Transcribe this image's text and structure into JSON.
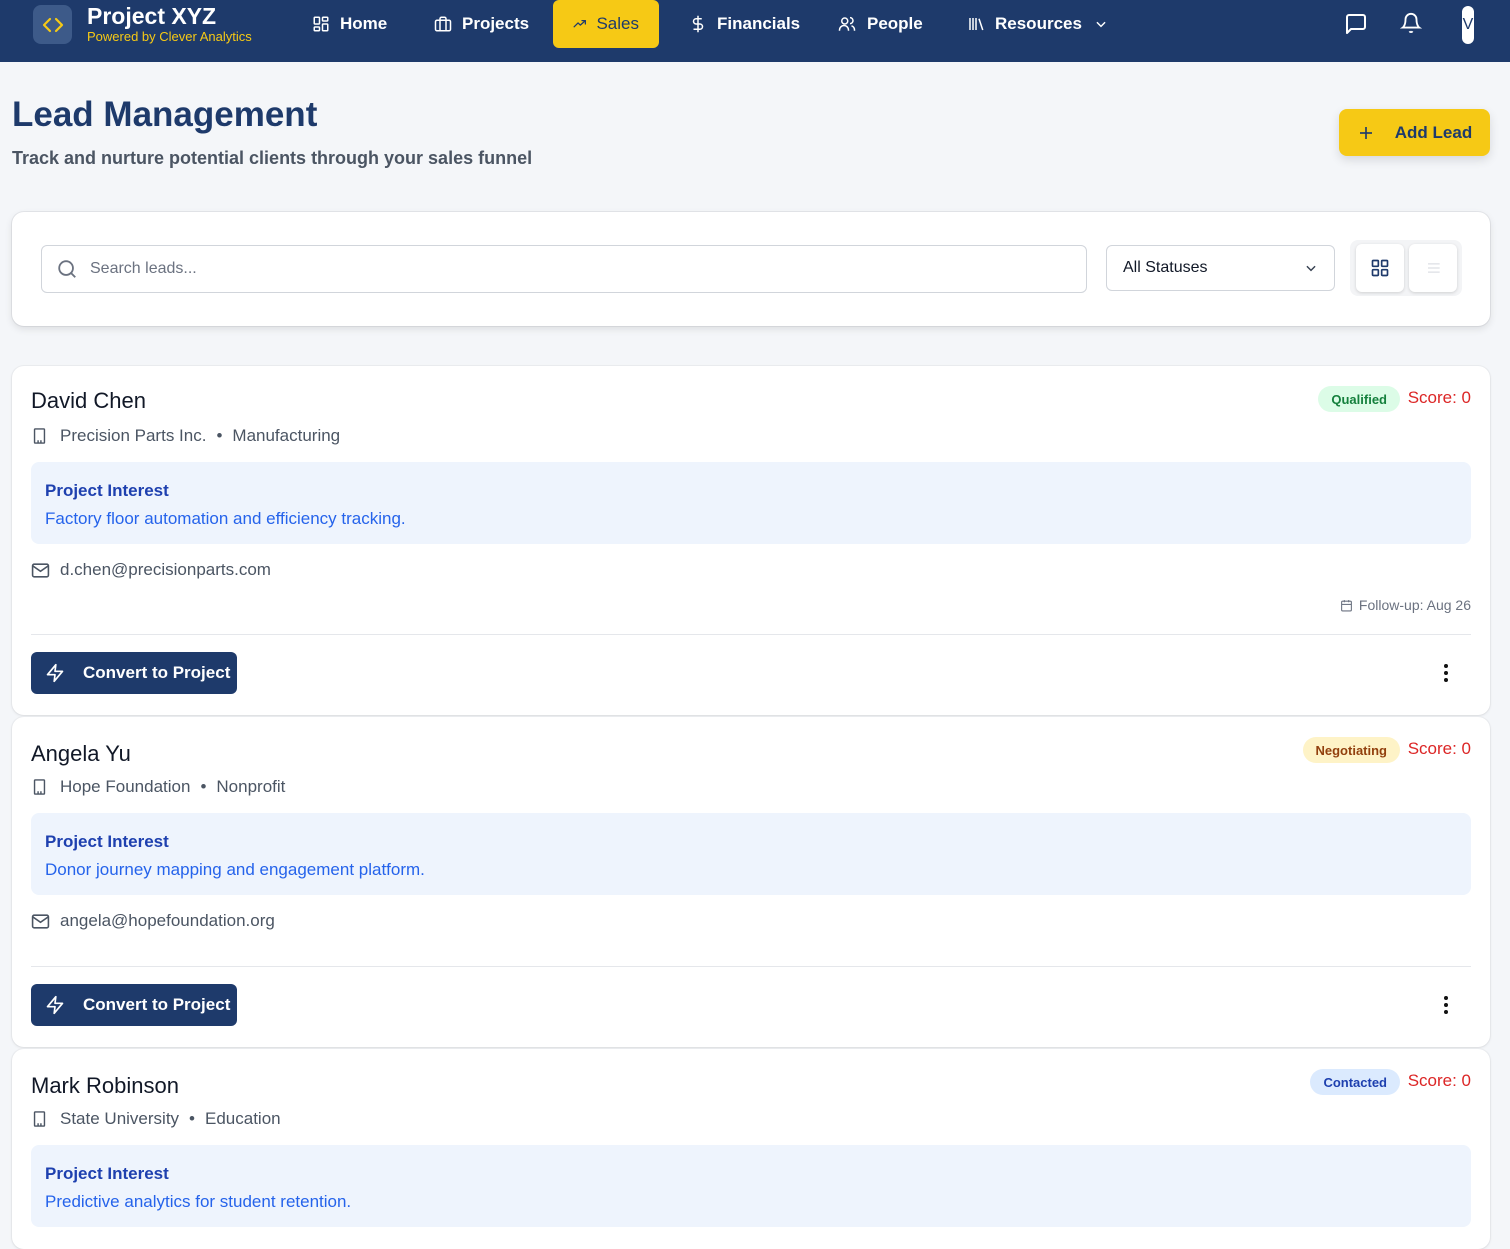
{
  "app": {
    "title": "Project XYZ",
    "subtitle": "Powered by Clever Analytics",
    "avatar_initial": "V"
  },
  "nav": {
    "items": [
      {
        "label": "Home",
        "icon": "grid-icon"
      },
      {
        "label": "Projects",
        "icon": "briefcase-icon"
      },
      {
        "label": "Sales",
        "icon": "trending-up-icon",
        "active": true
      },
      {
        "label": "Financials",
        "icon": "dollar-icon"
      },
      {
        "label": "People",
        "icon": "users-icon"
      },
      {
        "label": "Resources",
        "icon": "library-icon"
      }
    ]
  },
  "header": {
    "title": "Lead Management",
    "subtitle": "Track and nurture potential clients through your sales funnel",
    "add_label": "Add Lead"
  },
  "filters": {
    "search_placeholder": "Search leads...",
    "status_selected": "All Statuses"
  },
  "leads": [
    {
      "name": "David Chen",
      "status": "Qualified",
      "score": "Score: 0",
      "company": "Precision Parts Inc.",
      "industry": "Manufacturing",
      "interest_label": "Project Interest",
      "interest": "Factory floor automation and efficiency tracking.",
      "email": "d.chen@precisionparts.com",
      "followup": "Follow-up: Aug 26",
      "convert_label": "Convert to Project"
    },
    {
      "name": "Angela Yu",
      "status": "Negotiating",
      "score": "Score: 0",
      "company": "Hope Foundation",
      "industry": "Nonprofit",
      "interest_label": "Project Interest",
      "interest": "Donor journey mapping and engagement platform.",
      "email": "angela@hopefoundation.org",
      "convert_label": "Convert to Project"
    },
    {
      "name": "Mark Robinson",
      "status": "Contacted",
      "score": "Score: 0",
      "company": "State University",
      "industry": "Education",
      "interest_label": "Project Interest",
      "interest": "Predictive analytics for student retention."
    }
  ],
  "colors": {
    "nav_bg": "#1e3a6b",
    "accent": "#f6c915",
    "qualified_bg": "#dcfce7",
    "negotiating_bg": "#fef3c7",
    "contacted_bg": "#dbeafe",
    "score": "#dc2626"
  }
}
